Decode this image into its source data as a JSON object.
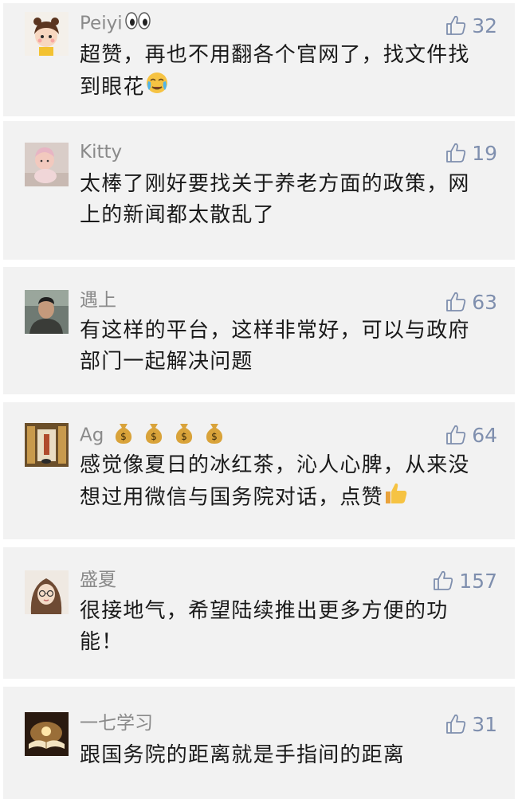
{
  "comments": [
    {
      "user": "Peiyi",
      "user_emoji": "eyes-icon",
      "likes": "32",
      "text": "超赞，再也不用翻各个官网了，找文件找到眼花",
      "text_emoji": "crying-face-icon",
      "avatar": "cartoon-girl-avatar"
    },
    {
      "user": "Kitty",
      "likes": "19",
      "text": "太棒了刚好要找关于养老方面的政策，网上的新闻都太散乱了",
      "avatar": "baby-photo-avatar"
    },
    {
      "user": "遇上",
      "likes": "63",
      "text": "有这样的平台，这样非常好，可以与政府部门一起解决问题",
      "avatar": "man-photo-avatar"
    },
    {
      "user": "Ag",
      "user_emoji": "money-bag-icon x4",
      "likes": "64",
      "text": "感觉像夏日的冰红茶，沁人心脾，从来没想过用微信与国务院对话，点赞",
      "text_emoji": "thumbs-up-icon",
      "avatar": "hallway-photo-avatar"
    },
    {
      "user": "盛夏",
      "likes": "157",
      "text": "很接地气，希望陆续推出更多方便的功能！",
      "avatar": "girl-glasses-drawing-avatar"
    },
    {
      "user": "一七学习",
      "likes": "31",
      "text": "跟国务院的距离就是手指间的距离",
      "avatar": "open-book-photo-avatar"
    }
  ],
  "colors": {
    "card_background": "#f2f2f2",
    "name_text": "#8a8a8a",
    "like_accent": "#7f8fae",
    "body_text": "#1a1a1a"
  }
}
